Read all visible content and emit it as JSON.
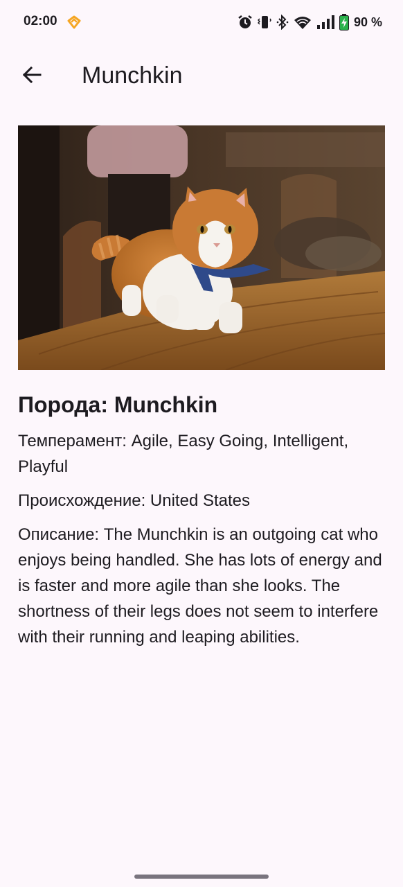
{
  "status_bar": {
    "time": "02:00",
    "battery_percent": "90 %",
    "icons": [
      "alarm-icon",
      "vibrate-icon",
      "bluetooth-icon",
      "wifi-icon",
      "signal-icon",
      "battery-charging-icon"
    ]
  },
  "app_bar": {
    "title": "Munchkin",
    "back_icon": "arrow-back-icon"
  },
  "hero_image": {
    "subject": "cat-photo"
  },
  "details": {
    "breed": "Порода: Munchkin",
    "temperament": "Темперамент: Agile, Easy Going, Intelligent, Playful",
    "origin": "Происхождение: United States",
    "description": "Описание: The Munchkin is an outgoing cat who enjoys being handled. She has lots of energy and is faster and more agile than she looks. The shortness of their legs does not seem to interfere with their running and leaping abilities."
  },
  "colors": {
    "background": "#fdf7fc",
    "text": "#1d1b20",
    "app_icon_accent": "#f5a623"
  }
}
